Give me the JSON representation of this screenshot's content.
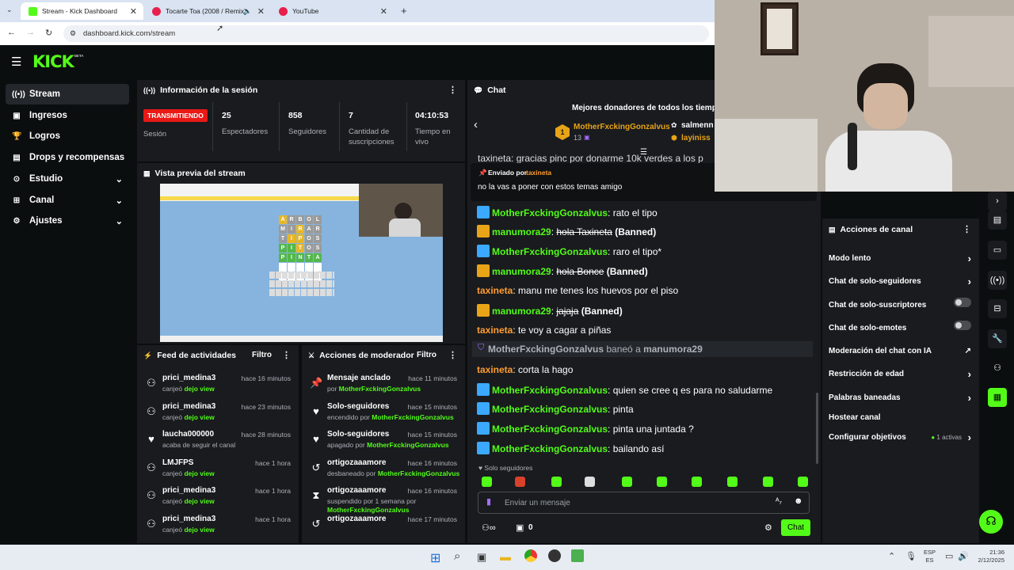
{
  "browser": {
    "tabs": [
      {
        "label": "Stream - Kick Dashboard",
        "active": true
      },
      {
        "label": "Tocarte Toa (2008 / Remix)",
        "active": false
      },
      {
        "label": "YouTube",
        "active": false
      }
    ],
    "url": "dashboard.kick.com/stream"
  },
  "kick": {
    "logo": "KICK",
    "beta": "BETA"
  },
  "sidebar": {
    "items": [
      {
        "label": "Stream",
        "icon": "broadcast-icon"
      },
      {
        "label": "Ingresos",
        "icon": "money-icon"
      },
      {
        "label": "Logros",
        "icon": "trophy-icon"
      },
      {
        "label": "Drops y recompensas",
        "icon": "gift-icon"
      },
      {
        "label": "Estudio",
        "icon": "studio-icon"
      },
      {
        "label": "Canal",
        "icon": "channel-icon"
      },
      {
        "label": "Ajustes",
        "icon": "gear-icon"
      }
    ]
  },
  "session": {
    "title": "Información de la sesión",
    "status": "TRANSMITIENDO",
    "status_label": "Sesión",
    "stats": [
      {
        "value": "25",
        "label": "Espectadores"
      },
      {
        "value": "858",
        "label": "Seguidores"
      },
      {
        "value": "7",
        "label": "Cantidad de suscripciones"
      },
      {
        "value": "04:10:53",
        "label": "Tiempo en vivo"
      }
    ]
  },
  "preview": {
    "title": "Vista previa del stream",
    "game_letters": [
      [
        "A",
        "R",
        "B",
        "O",
        "L"
      ],
      [
        "M",
        "I",
        "R",
        "A",
        "R"
      ],
      [
        "T",
        "I",
        "P",
        "O",
        "S"
      ],
      [
        "P",
        "I",
        "T",
        "O",
        "S"
      ],
      [
        "P",
        "I",
        "N",
        "T",
        "A"
      ]
    ]
  },
  "feed": {
    "title": "Feed de actividades",
    "filter": "Filtro",
    "rows": [
      {
        "name": "prici_medina3",
        "sub_pre": "canjeó",
        "sub_bold": "dejo view",
        "time": "hace 16 minutos"
      },
      {
        "name": "prici_medina3",
        "sub_pre": "canjeó",
        "sub_bold": "dejo view",
        "time": "hace 23 minutos"
      },
      {
        "name": "laucha000000",
        "sub_pre": "acaba de seguir el canal",
        "sub_bold": "",
        "time": "hace 28 minutos"
      },
      {
        "name": "LMJFPS",
        "sub_pre": "canjeó",
        "sub_bold": "dejo view",
        "time": "hace 1 hora"
      },
      {
        "name": "prici_medina3",
        "sub_pre": "canjeó",
        "sub_bold": "dejo view",
        "time": "hace 1 hora"
      },
      {
        "name": "prici_medina3",
        "sub_pre": "canjeó",
        "sub_bold": "dejo view",
        "time": "hace 1 hora"
      }
    ]
  },
  "mod": {
    "title": "Acciones de moderador",
    "filter": "Filtro",
    "rows": [
      {
        "name": "Mensaje anclado",
        "sub_pre": "por",
        "sub_bold": "MotherFxckingGonzalvus",
        "time": "hace 11 minutos"
      },
      {
        "name": "Solo-seguidores",
        "sub_pre": "encendido por",
        "sub_bold": "MotherFxckingGonzalvus",
        "time": "hace 15 minutos"
      },
      {
        "name": "Solo-seguidores",
        "sub_pre": "apagado por",
        "sub_bold": "MotherFxckingGonzalvus",
        "time": "hace 15 minutos"
      },
      {
        "name": "ortigozaaamore",
        "sub_pre": "desbaneado por",
        "sub_bold": "MotherFxckingGonzalvus",
        "time": "hace 16 minutos"
      },
      {
        "name": "ortigozaaamore",
        "sub_pre": "suspendido por 1 semana por",
        "sub_bold": "MotherFxckingGonzalvus",
        "time": "hace 16 minutos"
      },
      {
        "name": "ortigozaaamore",
        "sub_pre": "",
        "sub_bold": "",
        "time": "hace 17 minutos"
      }
    ]
  },
  "chat": {
    "title": "Chat",
    "donors_title": "Mejores donadores de todos los tiempos",
    "top_donor": {
      "rank": "1",
      "name": "MotherFxckingGonzalvus",
      "amount": "13"
    },
    "other_donors": [
      "salmenn",
      "layiniss"
    ],
    "partial_line": "taxineta: gracias pinc por donarme 10k verdes a los p",
    "pinned": {
      "label": "Enviado por",
      "author": "taxineta",
      "text": "no la vas a poner con estos temas amigo"
    },
    "messages": [
      {
        "user": "MotherFxckingGonzalvus",
        "text": ": rato el tipo",
        "badge": "kick"
      },
      {
        "user": "manumora29",
        "text": ": ",
        "strike": "hola Taxineta",
        "tag": " (Banned)",
        "badge": "crown"
      },
      {
        "user": "MotherFxckingGonzalvus",
        "text": ": raro el tipo*",
        "badge": "kick"
      },
      {
        "user": "manumora29",
        "text": ": ",
        "strike": "hola Bonce",
        "tag": " (Banned)",
        "badge": "crown"
      },
      {
        "user": "taxineta",
        "text": ": manu me tenes los huevos por el piso",
        "badge": "none"
      },
      {
        "user": "manumora29",
        "text": ": ",
        "strike": "jajaja",
        "tag": " (Banned)",
        "badge": "crown"
      },
      {
        "user": "taxineta",
        "text": ": te voy a cagar a piñas",
        "badge": "none"
      }
    ],
    "ban_notice": {
      "mod": "MotherFxckingGonzalvus",
      "verb": " baneó a ",
      "target": "manumora29"
    },
    "messages2": [
      {
        "user": "taxineta",
        "text": ": corta la hago",
        "badge": "none"
      },
      {
        "user": "MotherFxckingGonzalvus",
        "text": ": quien se cree q es para no saludarme",
        "badge": "kick"
      },
      {
        "user": "MotherFxckingGonzalvus",
        "text": ": pinta",
        "badge": "kick"
      },
      {
        "user": "MotherFxckingGonzalvus",
        "text": ": pinta una juntada ?",
        "badge": "kick"
      },
      {
        "user": "MotherFxckingGonzalvus",
        "text": ": bailando así",
        "badge": "kick"
      }
    ],
    "followers_only": "Solo seguidores",
    "input_placeholder": "Enviar un mensaje",
    "count": "0",
    "send_label": "Chat"
  },
  "channel_actions": {
    "title": "Acciones de canal",
    "items": [
      {
        "label": "Modo lento",
        "control": "chevron"
      },
      {
        "label": "Chat de solo-seguidores",
        "control": "chevron"
      },
      {
        "label": "Chat de solo-suscriptores",
        "control": "toggle"
      },
      {
        "label": "Chat de solo-emotes",
        "control": "toggle"
      },
      {
        "label": "Moderación del chat con IA",
        "control": "external"
      },
      {
        "label": "Restricción de edad",
        "control": "chevron"
      },
      {
        "label": "Palabras baneadas",
        "control": "chevron"
      },
      {
        "label": "Hostear canal",
        "control": "none"
      },
      {
        "label": "Configurar objetivos",
        "control": "chevron",
        "extra": "1 activas"
      }
    ]
  },
  "taskbar": {
    "lang1": "ESP",
    "lang2": "ES",
    "time": "21:36",
    "date": "2/12/2025"
  },
  "colors": {
    "accent": "#53fc18",
    "live": "#e91916",
    "panel": "#191b1f",
    "bg": "#0b0e0f"
  }
}
